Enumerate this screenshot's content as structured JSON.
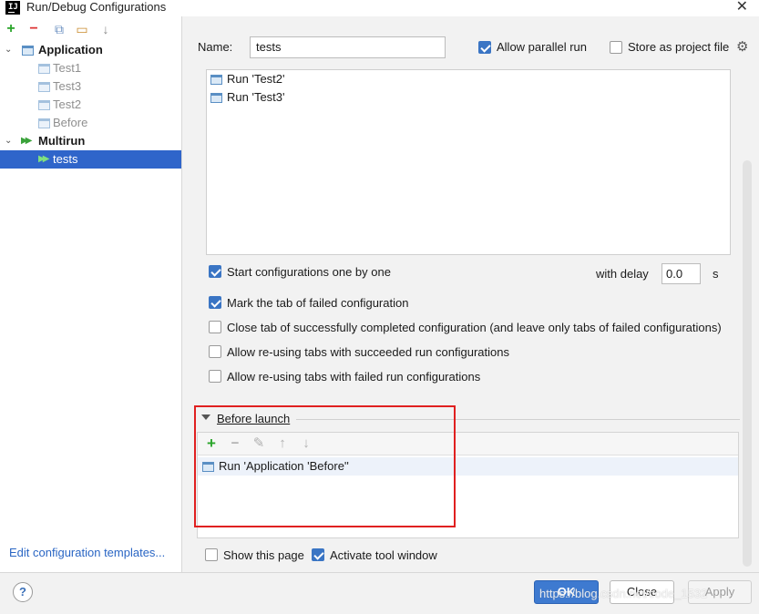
{
  "window": {
    "title": "Run/Debug Configurations",
    "app_icon_text": "IJ",
    "close_glyph": "✕"
  },
  "left_toolbar": {
    "add_icon": "+",
    "remove_icon": "−",
    "copy_icon": "⧉",
    "folder_icon": "▭",
    "sort_icon": "↓"
  },
  "tree": {
    "items": [
      {
        "label": "Application",
        "level": 0,
        "expanded": true,
        "bold": true,
        "icon": "application-config-icon"
      },
      {
        "label": "Test1",
        "level": 1,
        "faded": true,
        "icon": "application-config-icon"
      },
      {
        "label": "Test3",
        "level": 1,
        "faded": true,
        "icon": "application-config-icon"
      },
      {
        "label": "Test2",
        "level": 1,
        "faded": true,
        "icon": "application-config-icon"
      },
      {
        "label": "Before",
        "level": 1,
        "faded": true,
        "icon": "application-config-icon"
      },
      {
        "label": "Multirun",
        "level": 0,
        "expanded": true,
        "bold": true,
        "icon": "multirun-icon"
      },
      {
        "label": "tests",
        "level": 1,
        "selected": true,
        "icon": "multirun-icon"
      }
    ],
    "expand_glyph": "⌄",
    "multirun_glyph": "▶▶"
  },
  "edit_templates_link": "Edit configuration templates...",
  "form": {
    "name_label": "Name:",
    "name_value": "tests",
    "allow_parallel_run": {
      "label": "Allow parallel run",
      "checked": true
    },
    "store_as_project_file": {
      "label": "Store as project file",
      "checked": false
    },
    "gear_icon": "⚙"
  },
  "run_list": [
    {
      "label": "Run 'Test2'"
    },
    {
      "label": "Run 'Test3'"
    }
  ],
  "options": {
    "start_one_by_one": {
      "label": "Start configurations one by one",
      "checked": true
    },
    "with_delay_label": "with delay",
    "delay_value": "0.0",
    "delay_unit": "s",
    "mark_failed": {
      "label": "Mark the tab of failed configuration",
      "checked": true
    },
    "close_successful": {
      "label": "Close tab of successfully completed configuration (and leave only tabs of failed configurations)",
      "checked": false
    },
    "reuse_succeeded": {
      "label": "Allow re-using tabs with succeeded run configurations",
      "checked": false
    },
    "reuse_failed": {
      "label": "Allow re-using tabs with failed run configurations",
      "checked": false
    }
  },
  "before_launch": {
    "title": "Before launch",
    "toolbar": {
      "add": "+",
      "remove": "−",
      "edit": "✎",
      "up": "↑",
      "down": "↓"
    },
    "items": [
      {
        "label": "Run 'Application 'Before''"
      }
    ],
    "highlight_color": "#e02020"
  },
  "footer_options": {
    "show_this_page": {
      "label": "Show this page",
      "checked": false
    },
    "activate_tool_window": {
      "label": "Activate tool window",
      "checked": true
    }
  },
  "buttons": {
    "help": "?",
    "ok": "OK",
    "close": "Close",
    "apply": "Apply"
  },
  "watermark": "https://blog.csdn.net/code_1532",
  "colors": {
    "selection": "#2f65ca",
    "primary_button": "#3e7ad0",
    "link": "#2a66c4",
    "checkbox_on": "#3a75c4"
  }
}
